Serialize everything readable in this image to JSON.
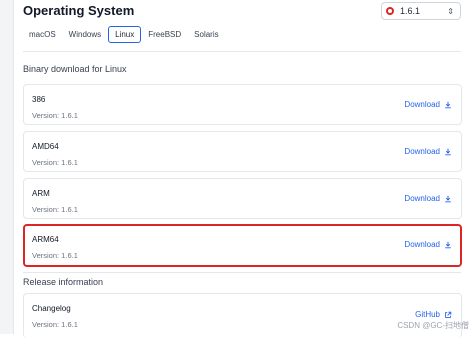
{
  "header": {
    "title": "Operating System",
    "version_selector": {
      "value": "1.6.1"
    }
  },
  "tabs": [
    {
      "label": "macOS"
    },
    {
      "label": "Windows"
    },
    {
      "label": "Linux",
      "active": true
    },
    {
      "label": "FreeBSD"
    },
    {
      "label": "Solaris"
    }
  ],
  "binary_section": {
    "title": "Binary download for Linux",
    "items": [
      {
        "name": "386",
        "version": "Version: 1.6.1",
        "link": "Download"
      },
      {
        "name": "AMD64",
        "version": "Version: 1.6.1",
        "link": "Download"
      },
      {
        "name": "ARM",
        "version": "Version: 1.6.1",
        "link": "Download"
      },
      {
        "name": "ARM64",
        "version": "Version: 1.6.1",
        "link": "Download"
      }
    ]
  },
  "release_section": {
    "title": "Release information",
    "changelog": {
      "name": "Changelog",
      "version": "Version: 1.6.1",
      "link": "GitHub"
    }
  },
  "watermark": "CSDN @GC-扫地僧",
  "colors": {
    "accent": "#2563eb",
    "highlight": "#dc2626",
    "border": "#e5e7eb"
  }
}
